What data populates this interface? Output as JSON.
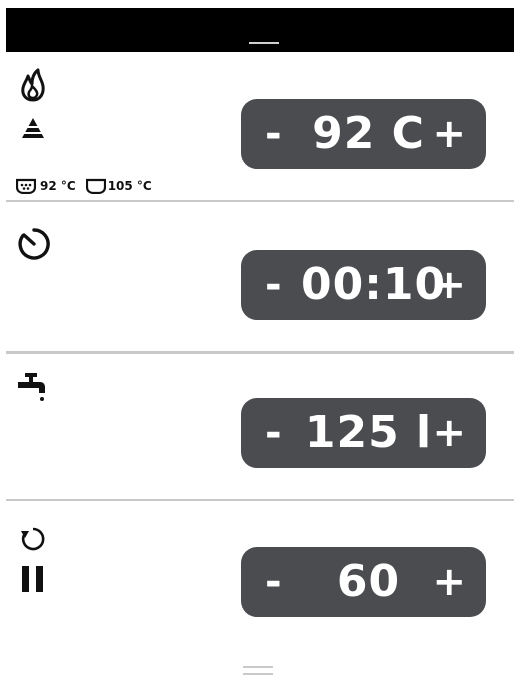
{
  "heat": {
    "value": "92 C",
    "minus": "-",
    "plus": "+",
    "temp_a": "92 °C",
    "temp_b": "105 °C"
  },
  "timer": {
    "value": "00:10",
    "minus": "-",
    "plus": "+"
  },
  "water": {
    "value": "125 l",
    "minus": "-",
    "plus": "+"
  },
  "cycles": {
    "value": "60",
    "minus": "-",
    "plus": "+"
  },
  "icons": [
    "flame-icon",
    "heat-level-icon",
    "pot-icon",
    "kettle-icon",
    "timer-icon",
    "faucet-icon",
    "repeat-icon",
    "pause-icon"
  ]
}
